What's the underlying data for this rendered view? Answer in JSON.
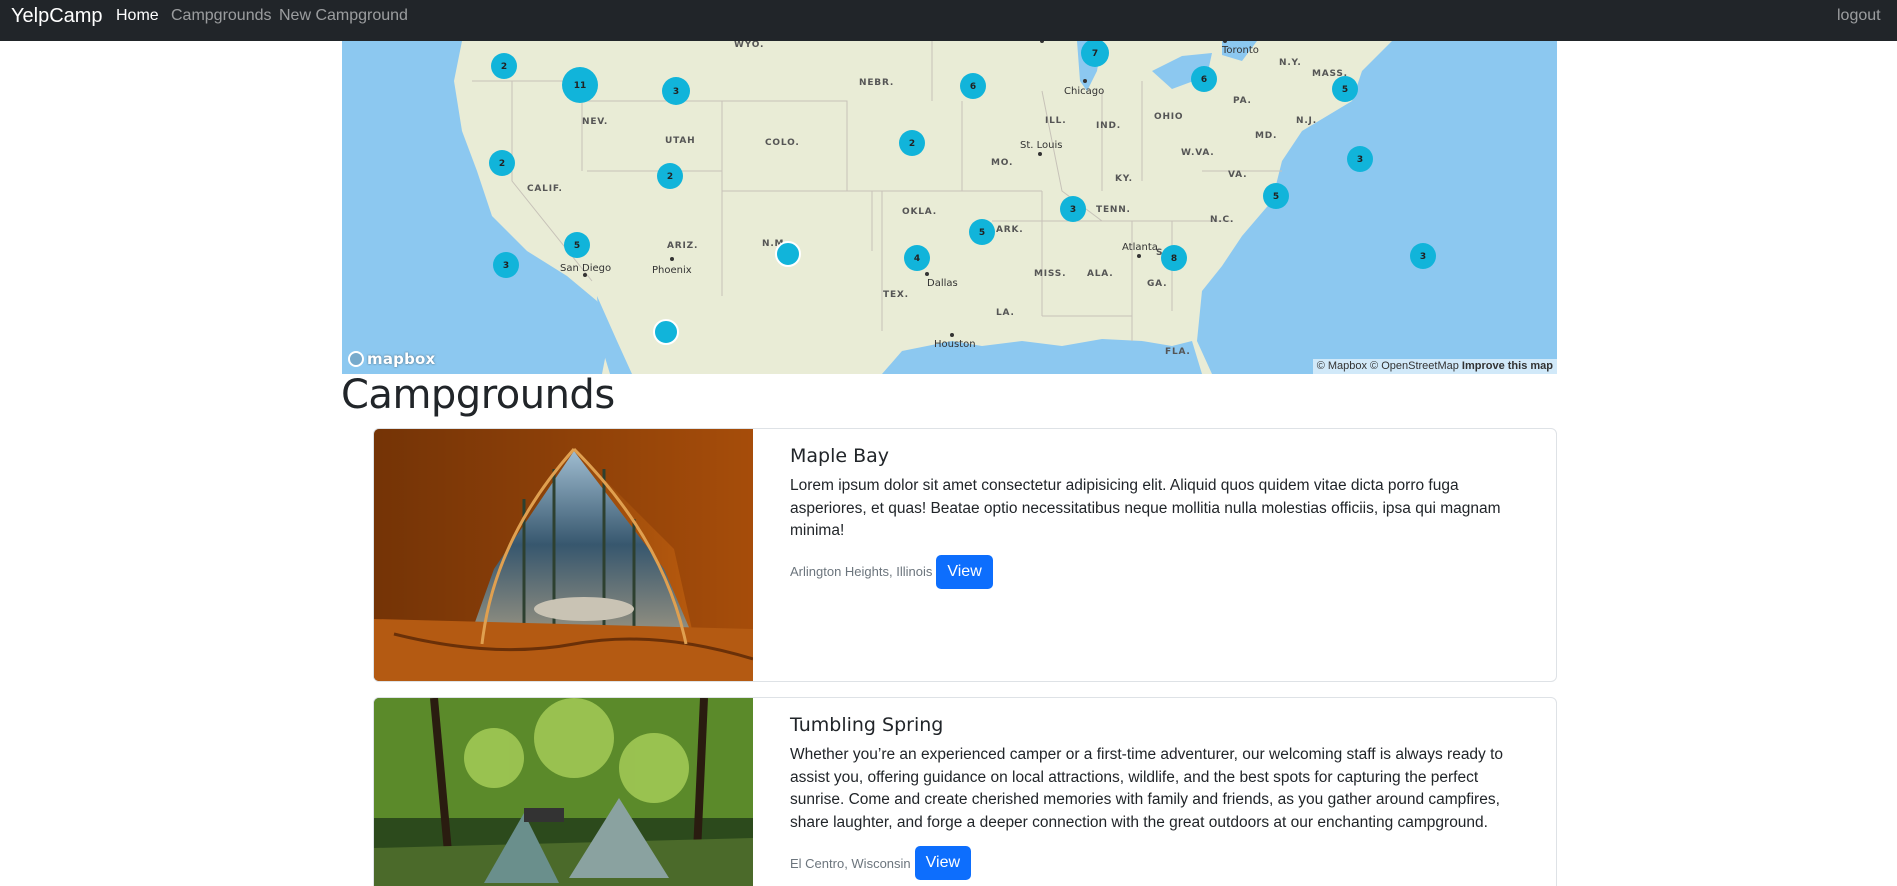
{
  "navbar": {
    "brand": "YelpCamp",
    "links": [
      {
        "label": "Home",
        "active": true
      },
      {
        "label": "Campgrounds",
        "active": false
      },
      {
        "label": "New Campground",
        "active": false
      }
    ],
    "logout": "logout"
  },
  "map": {
    "labels": {
      "wyo": "WYO.",
      "toronto": "Toronto",
      "ny": "N.Y.",
      "nebr": "NEBR.",
      "mass": "MASS.",
      "nev": "NEV.",
      "chicago": "Chicago",
      "pa": "PA.",
      "utah": "UTAH",
      "ill": "ILL.",
      "ind": "IND.",
      "ohio": "OHIO",
      "nj": "N.J.",
      "colo": "COLO.",
      "md": "MD.",
      "mo": "MO.",
      "stlouis": "St. Louis",
      "calif": "CALIF.",
      "wva": "W.VA.",
      "ky": "KY.",
      "va": "VA.",
      "tenn": "TENN.",
      "okla": "OKLA.",
      "nc": "N.C.",
      "ark": "ARK.",
      "ariz": "ARIZ.",
      "nm": "N.M.",
      "atlanta": "Atlanta",
      "sc": "S.C.",
      "sandiego": "San Diego",
      "phoenix": "Phoenix",
      "miss": "MISS.",
      "ala": "ALA.",
      "ga": "GA.",
      "dallas": "Dallas",
      "tex": "TEX.",
      "la": "LA.",
      "houston": "Houston",
      "fla": "FLA."
    },
    "clusters": [
      "2",
      "11",
      "3",
      "7",
      "6",
      "6",
      "5",
      "2",
      "2",
      "3",
      "2",
      "3",
      "5",
      "3",
      "4",
      "5",
      "8",
      "3",
      "5"
    ],
    "logo": "mapbox",
    "attribution": "© Mapbox © OpenStreetMap",
    "improve": "Improve this map",
    "colors": {
      "water": "#8cc8f0",
      "land": "#e9ecd6",
      "marker": "#11b4da"
    }
  },
  "page_title": "Campgrounds",
  "campgrounds": [
    {
      "title": "Maple Bay",
      "description": "Lorem ipsum dolor sit amet consectetur adipisicing elit. Aliquid quos quidem vitae dicta porro fuga asperiores, et quas! Beatae optio necessitatibus neque mollitia nulla molestias officiis, ipsa qui magnam minima!",
      "location": "Arlington Heights, Illinois",
      "button": "View"
    },
    {
      "title": "Tumbling Spring",
      "description": "Whether you’re an experienced camper or a first-time adventurer, our welcoming staff is always ready to assist you, offering guidance on local attractions, wildlife, and the best spots for capturing the perfect sunrise. Come and create cherished memories with family and friends, as you gather around campfires, share laughter, and forge a deeper connection with the great outdoors at our enchanting campground.",
      "location": "El Centro, Wisconsin",
      "button": "View"
    }
  ]
}
